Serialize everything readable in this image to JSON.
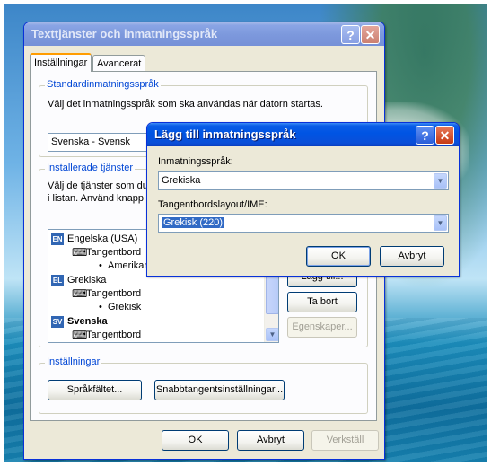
{
  "main_dialog": {
    "title": "Texttjänster och inmatningsspråk",
    "help_glyph": "?",
    "close_glyph": "✕",
    "tabs": [
      {
        "label": "Inställningar",
        "active": true
      },
      {
        "label": "Avancerat",
        "active": false
      }
    ],
    "default_language": {
      "group_label": "Standardinmatningsspråk",
      "description": "Välj det inmatningsspråk som ska användas när datorn startas.",
      "selected_value": "Svenska - Svensk"
    },
    "installed_services": {
      "group_label": "Installerade tjänster",
      "description_line1": "Välj de tjänster som du",
      "description_line2": "i listan. Använd knapp",
      "list": [
        {
          "type": "lang",
          "badge": "EN",
          "label": "Engelska (USA)",
          "bold": false
        },
        {
          "type": "category",
          "label": "Tangentbord"
        },
        {
          "type": "item",
          "bullet": "•",
          "label": "Amerikan"
        },
        {
          "type": "lang",
          "badge": "EL",
          "label": "Grekiska",
          "bold": false
        },
        {
          "type": "category",
          "label": "Tangentbord"
        },
        {
          "type": "item",
          "bullet": "•",
          "label": "Grekisk"
        },
        {
          "type": "lang",
          "badge": "SV",
          "label": "Svenska",
          "bold": true
        },
        {
          "type": "category",
          "label": "Tangentbord"
        }
      ],
      "buttons": {
        "add": "Lägg till...",
        "remove": "Ta bort",
        "properties": "Egenskaper..."
      }
    },
    "settings": {
      "group_label": "Inställningar",
      "language_bar_button": "Språkfältet...",
      "hotkey_button": "Snabbtangentsinställningar..."
    },
    "footer": {
      "ok": "OK",
      "cancel": "Avbryt",
      "apply": "Verkställ"
    }
  },
  "add_dialog": {
    "title": "Lägg till inmatningsspråk",
    "help_glyph": "?",
    "close_glyph": "✕",
    "input_language_label": "Inmatningsspråk:",
    "input_language_value": "Grekiska",
    "keyboard_layout_label": "Tangentbordslayout/IME:",
    "keyboard_layout_value": "Grekisk (220)",
    "ok": "OK",
    "cancel": "Avbryt"
  },
  "icons": {
    "keyboard_glyph": "⌨",
    "dropdown_glyph": "▼",
    "scroll_up_glyph": "▲",
    "scroll_down_glyph": "▼"
  },
  "colors": {
    "titlebar_active": "#0054e3",
    "titlebar_inactive": "#7d99dd",
    "dialog_bg": "#ece9d8",
    "selection": "#316ac5",
    "group_label": "#0046d5"
  }
}
